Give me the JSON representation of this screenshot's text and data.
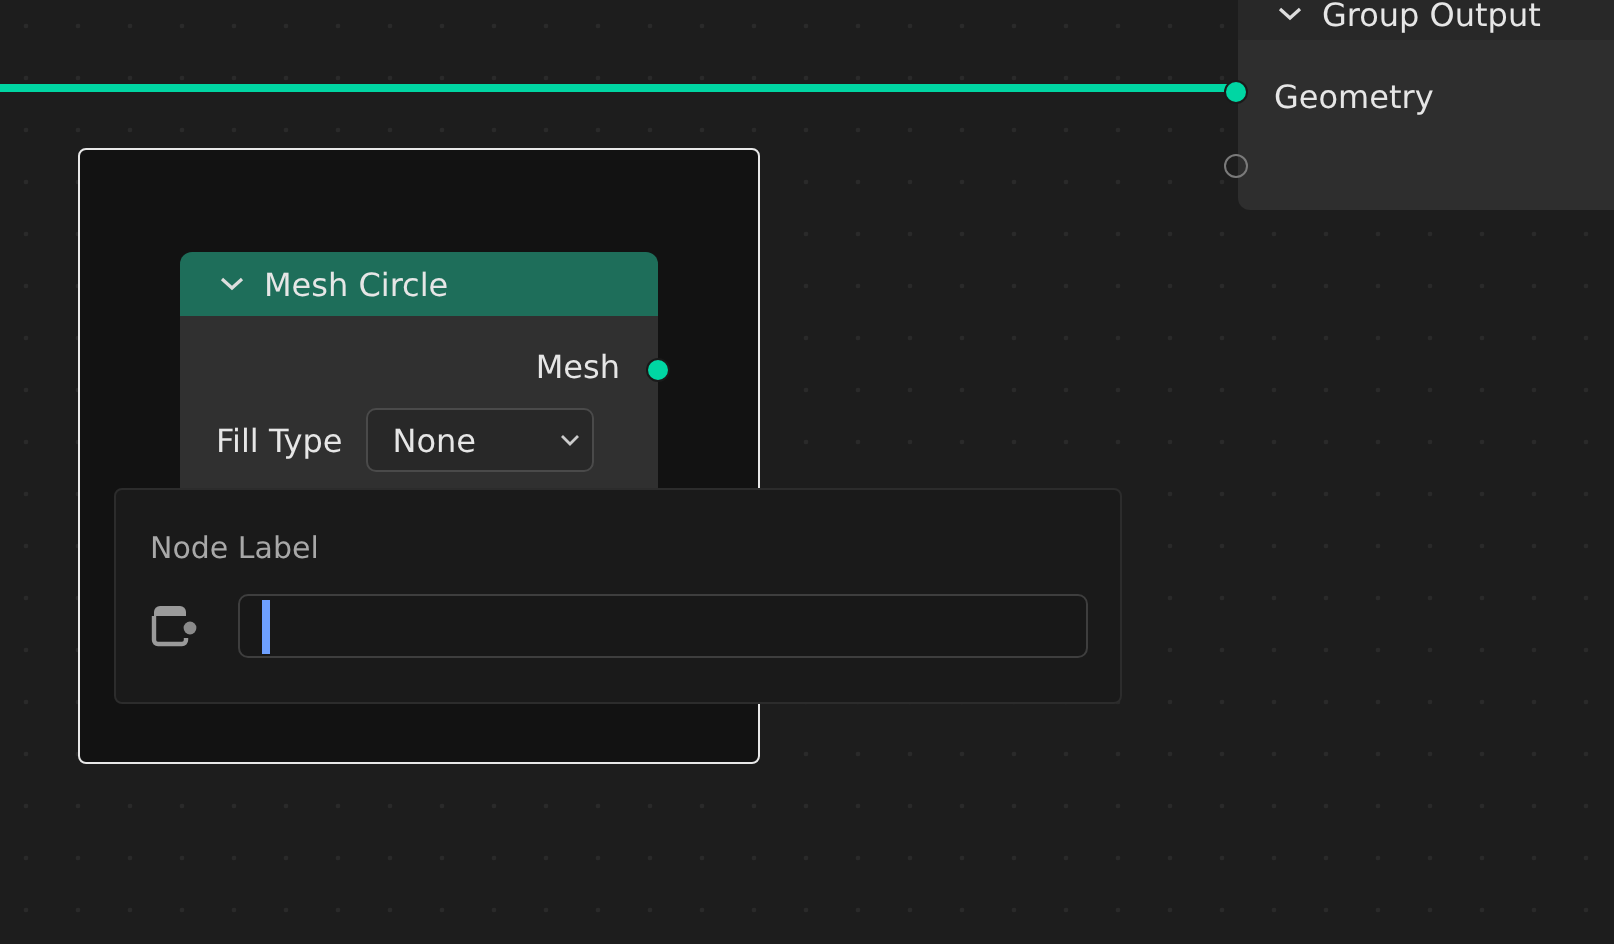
{
  "link": {
    "color": "#00d6a3"
  },
  "frame": {
    "selected": true
  },
  "group_output": {
    "title": "Group Output",
    "sockets": [
      {
        "label": "Geometry",
        "linked": true
      },
      {
        "linked": false
      }
    ]
  },
  "mesh_circle": {
    "title": "Mesh Circle",
    "expanded": true,
    "outputs": [
      {
        "label": "Mesh",
        "linked": false
      }
    ],
    "fill_type": {
      "label": "Fill Type",
      "value": "None"
    }
  },
  "popup": {
    "title": "Node Label"
  }
}
